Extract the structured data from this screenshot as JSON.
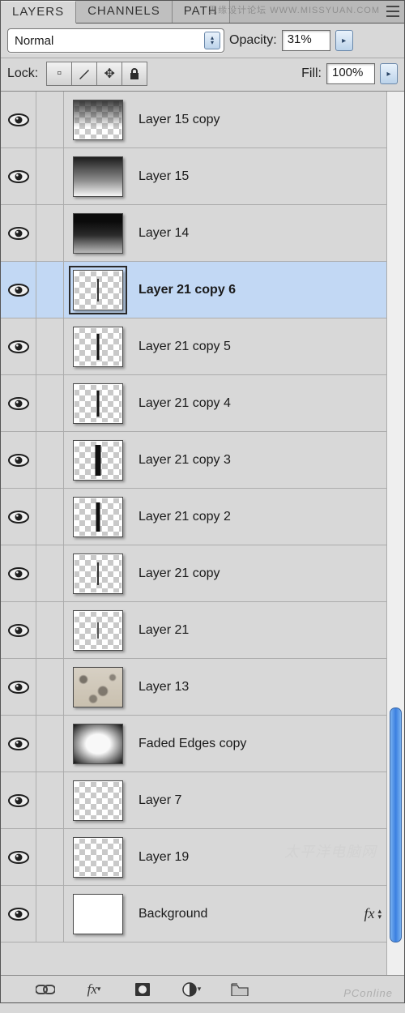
{
  "tabs": {
    "layers": "LAYERS",
    "channels": "CHANNELS",
    "paths": "PATH"
  },
  "watermark_top": "思缘设计论坛  WWW.MISSYUAN.COM",
  "blend": {
    "mode": "Normal",
    "opacity_label": "Opacity:",
    "opacity_value": "31%"
  },
  "lock": {
    "label": "Lock:",
    "fill_label": "Fill:",
    "fill_value": "100%"
  },
  "layers": [
    {
      "name": "Layer 15 copy",
      "thumb": "checker overlay-top-grad"
    },
    {
      "name": "Layer 15",
      "thumb": "checker overlay-full-grad"
    },
    {
      "name": "Layer 14",
      "thumb": "checker overlay-full-dark"
    },
    {
      "name": "Layer 21 copy 6",
      "thumb": "checker vbar thin-s",
      "selected": true
    },
    {
      "name": "Layer 21 copy 5",
      "thumb": "checker vbar thin-m"
    },
    {
      "name": "Layer 21 copy 4",
      "thumb": "checker vbar thin-m"
    },
    {
      "name": "Layer 21 copy 3",
      "thumb": "checker vbar thin-xl"
    },
    {
      "name": "Layer 21 copy 2",
      "thumb": "checker vbar thin-l"
    },
    {
      "name": "Layer 21 copy",
      "thumb": "checker vbar thin-s"
    },
    {
      "name": "Layer 21",
      "thumb": "checker vbar tiny"
    },
    {
      "name": "Layer 13",
      "thumb": "texture"
    },
    {
      "name": "Faded Edges copy",
      "thumb": "vignette"
    },
    {
      "name": "Layer 7",
      "thumb": "checker"
    },
    {
      "name": "Layer 19",
      "thumb": "checker"
    },
    {
      "name": "Background",
      "thumb": "solid-white",
      "fx": true
    }
  ],
  "fx_label": "fx",
  "watermark_mid": "太平洋电脑网",
  "watermark_bottom": "PConline"
}
